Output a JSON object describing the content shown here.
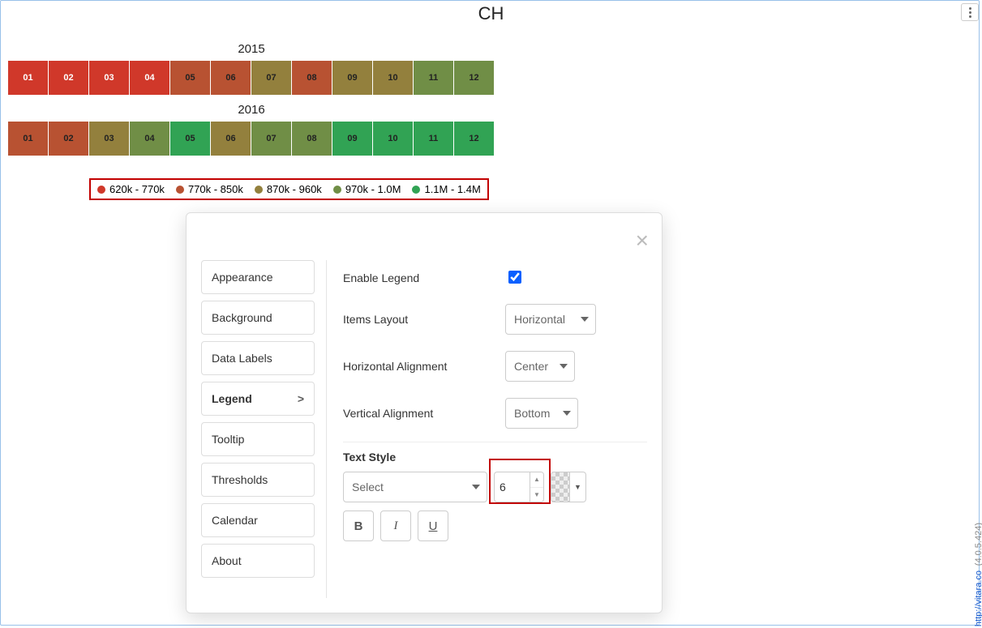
{
  "title": "CH",
  "chart_data": {
    "type": "heatmap",
    "series": [
      {
        "year": "2015",
        "cells": [
          {
            "label": "01",
            "color": "#d0382a",
            "text": "#fff"
          },
          {
            "label": "02",
            "color": "#d0382a",
            "text": "#fff"
          },
          {
            "label": "03",
            "color": "#d0382a",
            "text": "#fff"
          },
          {
            "label": "04",
            "color": "#d0382a",
            "text": "#fff"
          },
          {
            "label": "05",
            "color": "#b85232",
            "text": "#222"
          },
          {
            "label": "06",
            "color": "#b85232",
            "text": "#222"
          },
          {
            "label": "07",
            "color": "#93803d",
            "text": "#222"
          },
          {
            "label": "08",
            "color": "#b85232",
            "text": "#222"
          },
          {
            "label": "09",
            "color": "#93803d",
            "text": "#222"
          },
          {
            "label": "10",
            "color": "#93803d",
            "text": "#222"
          },
          {
            "label": "11",
            "color": "#708e46",
            "text": "#222"
          },
          {
            "label": "12",
            "color": "#708e46",
            "text": "#222"
          }
        ]
      },
      {
        "year": "2016",
        "cells": [
          {
            "label": "01",
            "color": "#b85232",
            "text": "#222"
          },
          {
            "label": "02",
            "color": "#b85232",
            "text": "#222"
          },
          {
            "label": "03",
            "color": "#93803d",
            "text": "#222"
          },
          {
            "label": "04",
            "color": "#708e46",
            "text": "#222"
          },
          {
            "label": "05",
            "color": "#31a354",
            "text": "#222"
          },
          {
            "label": "06",
            "color": "#93803d",
            "text": "#222"
          },
          {
            "label": "07",
            "color": "#708e46",
            "text": "#222"
          },
          {
            "label": "08",
            "color": "#708e46",
            "text": "#222"
          },
          {
            "label": "09",
            "color": "#31a354",
            "text": "#222"
          },
          {
            "label": "10",
            "color": "#31a354",
            "text": "#222"
          },
          {
            "label": "11",
            "color": "#31a354",
            "text": "#222"
          },
          {
            "label": "12",
            "color": "#31a354",
            "text": "#222"
          }
        ]
      }
    ],
    "legend": [
      {
        "color": "#d0382a",
        "label": "620k - 770k"
      },
      {
        "color": "#b85232",
        "label": "770k - 850k"
      },
      {
        "color": "#93803d",
        "label": "870k - 960k"
      },
      {
        "color": "#708e46",
        "label": "970k - 1.0M"
      },
      {
        "color": "#31a354",
        "label": "1.1M - 1.4M"
      }
    ]
  },
  "settings": {
    "tabs": [
      {
        "key": "appearance",
        "label": "Appearance"
      },
      {
        "key": "background",
        "label": "Background"
      },
      {
        "key": "datalabels",
        "label": "Data Labels"
      },
      {
        "key": "legend",
        "label": "Legend",
        "active": true
      },
      {
        "key": "tooltip",
        "label": "Tooltip"
      },
      {
        "key": "thresholds",
        "label": "Thresholds"
      },
      {
        "key": "calendar",
        "label": "Calendar"
      },
      {
        "key": "about",
        "label": "About"
      }
    ],
    "form": {
      "enable_legend_label": "Enable Legend",
      "enable_legend_value": true,
      "items_layout_label": "Items Layout",
      "items_layout_value": "Horizontal",
      "h_align_label": "Horizontal Alignment",
      "h_align_value": "Center",
      "v_align_label": "Vertical Alignment",
      "v_align_value": "Bottom",
      "text_style_label": "Text Style",
      "font_placeholder": "Select",
      "font_size_value": "6",
      "bold": "B",
      "italic": "I",
      "underline": "U"
    }
  },
  "watermark": {
    "version": "(4.0.5.424)",
    "link": "http://vitara.co"
  }
}
